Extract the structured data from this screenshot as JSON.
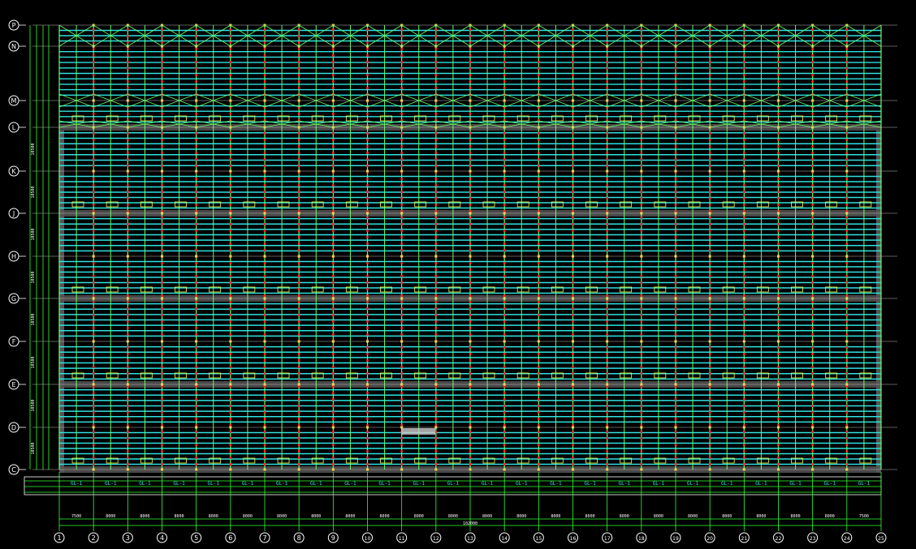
{
  "drawing": {
    "row_axes": [
      "P",
      "N",
      "M",
      "L",
      "K",
      "J",
      "H",
      "G",
      "F",
      "E",
      "D",
      "C"
    ],
    "col_axes": [
      "1",
      "2",
      "3",
      "4",
      "5",
      "6",
      "7",
      "8",
      "9",
      "10",
      "11",
      "12",
      "13",
      "14",
      "15",
      "16",
      "17",
      "18",
      "19",
      "20",
      "21",
      "22",
      "23",
      "24",
      "25"
    ],
    "overall_dimension": "102000",
    "span_dimensions": [
      "7500",
      "8000",
      "8000",
      "8000",
      "8000",
      "8000",
      "8000",
      "8000",
      "8000",
      "8000",
      "8000",
      "8000",
      "8000",
      "8000",
      "8000",
      "8000",
      "8000",
      "8000",
      "8000",
      "8000",
      "8000",
      "8000",
      "8000",
      "7500"
    ],
    "left_dimensions": [
      "10500",
      "10500",
      "10500",
      "10500",
      "10500",
      "10500",
      "10500",
      "10500"
    ],
    "purlin_label": "GL-1",
    "colors": {
      "background": "#000000",
      "axis_line": "#ffffff",
      "purlin": "#2fe0e0",
      "rafter": "#66ff66",
      "tie": "#ff2a2a",
      "beam_band": "#555555",
      "label": "#ffff33",
      "dimension": "#33ff33"
    }
  }
}
